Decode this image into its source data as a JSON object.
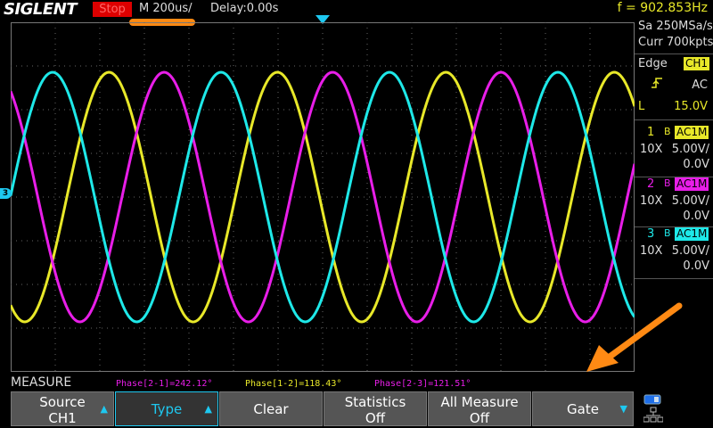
{
  "brand": "SIGLENT",
  "status": "Stop",
  "timebase": "M 200us/",
  "delay": "Delay:0.00s",
  "frequency": "f = 902.853Hz",
  "sample_rate": "Sa 250MSa/s",
  "memory": "Curr 700kpts",
  "trigger": {
    "label": "Edge",
    "source": "CH1",
    "coupling": "AC",
    "level_prefix": "L",
    "level": "15.0V"
  },
  "channels": [
    {
      "num": "1",
      "bw": "B",
      "coupling": "AC1M",
      "probe": "10X",
      "scale": "5.00V/",
      "offset": "0.0V",
      "color": "#e8e829"
    },
    {
      "num": "2",
      "bw": "B",
      "coupling": "AC1M",
      "probe": "10X",
      "scale": "5.00V/",
      "offset": "0.0V",
      "color": "#e81ee8"
    },
    {
      "num": "3",
      "bw": "B",
      "coupling": "AC1M",
      "probe": "10X",
      "scale": "5.00V/",
      "offset": "0.0V",
      "color": "#1ee8e8"
    }
  ],
  "ch3_marker": "3",
  "measure": {
    "title": "MEASURE",
    "items": [
      {
        "text": "Phase[2-1]=242.12°",
        "color": "#e81ee8"
      },
      {
        "text": "Phase[1-2]=118.43°",
        "color": "#e8e829"
      },
      {
        "text": "Phase[2-3]=121.51°",
        "color": "#e81ee8"
      }
    ]
  },
  "softkeys": [
    {
      "line1": "Source",
      "line2": "CH1",
      "arrow": "▲"
    },
    {
      "line1": "Type",
      "line2": "",
      "arrow": "▲"
    },
    {
      "line1": "Clear",
      "line2": "",
      "arrow": ""
    },
    {
      "line1": "Statistics",
      "line2": "Off",
      "arrow": ""
    },
    {
      "line1": "All Measure",
      "line2": "Off",
      "arrow": ""
    },
    {
      "line1": "Gate",
      "line2": "",
      "arrow": "▼"
    }
  ],
  "icons": {
    "network": "network-icon",
    "usb": "usb-icon"
  },
  "accent": "#ff8a14"
}
